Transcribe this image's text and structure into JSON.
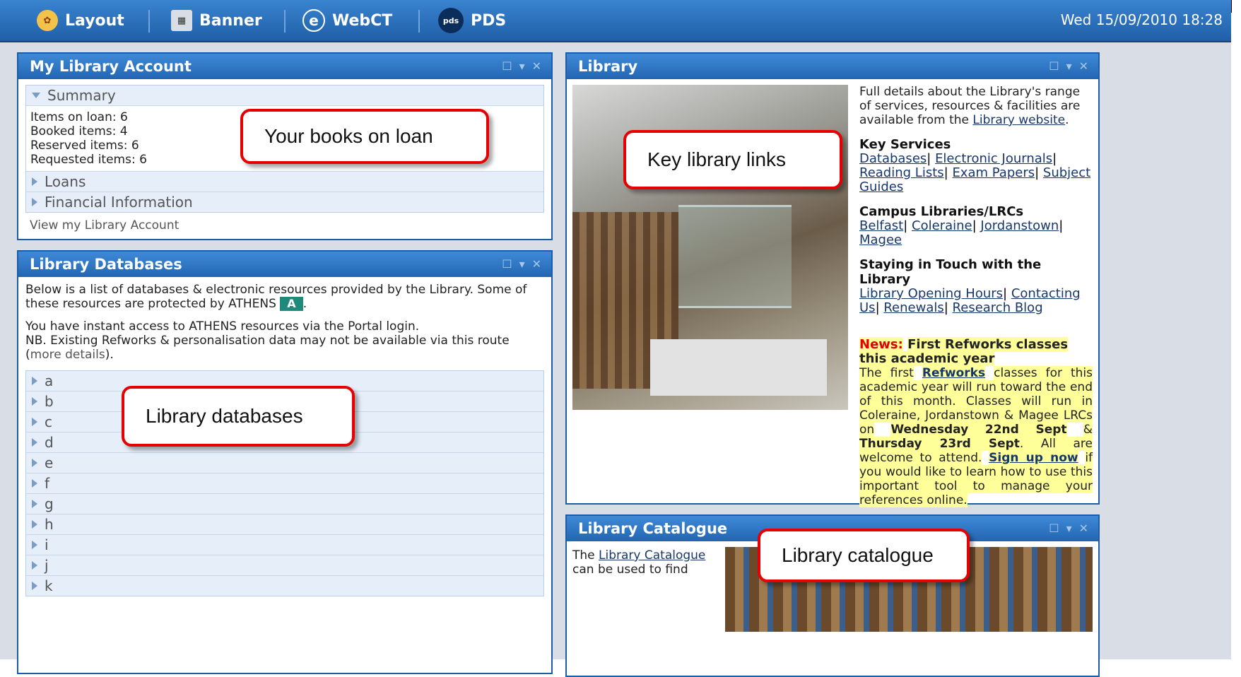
{
  "topbar": {
    "nav": [
      {
        "label": "Layout"
      },
      {
        "label": "Banner"
      },
      {
        "label": "WebCT"
      },
      {
        "label": "PDS"
      }
    ],
    "pds_icon_text": "pds",
    "datetime": "Wed 15/09/2010 18:28"
  },
  "colors": {
    "header_blue": "#2266b3",
    "callout_red": "#e60000",
    "news_highlight": "#ffff99"
  },
  "account": {
    "title": "My Library Account",
    "summary_label": "Summary",
    "items": [
      "Items on loan: 6",
      "Booked items: 4",
      "Reserved items: 6",
      "Requested items: 6"
    ],
    "loans_label": "Loans",
    "financial_label": "Financial Information",
    "view_link": "View my Library Account"
  },
  "databases": {
    "title": "Library Databases",
    "intro": "Below is a list of databases & electronic resources provided by the Library. Some of these resources are protected by ATHENS",
    "athens_badge": "A",
    "access_text": "You have instant access to ATHENS resources via the Portal login.",
    "nb_text": "NB. Existing Refworks & personalisation data may not be available via this route",
    "more_details": "more details",
    "letters": [
      "a",
      "b",
      "c",
      "d",
      "e",
      "f",
      "g",
      "h",
      "i",
      "j",
      "k"
    ]
  },
  "library": {
    "title": "Library",
    "intro": "Full details about the Library's range of services, resources & facilities are available from the",
    "website_link": "Library website",
    "key_services_title": "Key Services",
    "key_services": [
      "Databases",
      "Electronic Journals",
      "Reading Lists",
      "Exam Papers",
      "Subject Guides"
    ],
    "campus_title": "Campus Libraries/LRCs",
    "campuses": [
      "Belfast",
      "Coleraine",
      "Jordanstown",
      "Magee"
    ],
    "touch_title": "Staying in Touch with the Library",
    "touch_links": [
      "Library Opening Hours",
      "Contacting Us",
      "Renewals",
      "Research Blog"
    ],
    "news_label": "News:",
    "news_title": "First Refworks classes this academic year",
    "news_text_1": "The first",
    "news_refworks": "Refworks",
    "news_text_2": "classes for this academic year will run toward the end of this month. Classes will run in Coleraine, Jordanstown & Magee LRCs on",
    "news_date1": "Wednesday 22nd Sept",
    "news_and": "&",
    "news_date2": "Thursday 23rd Sept",
    "news_text_3": ". All are welcome to attend.",
    "news_signup": "Sign up now",
    "news_text_4": "if you would like to learn how to use this important tool to manage your references online."
  },
  "catalogue": {
    "title": "Library Catalogue",
    "text_1": "The",
    "link": "Library Catalogue",
    "text_2": "can be used to find"
  },
  "callouts": {
    "books": "Your books on loan",
    "key_links": "Key library links",
    "databases": "Library databases",
    "catalogue": "Library catalogue"
  }
}
